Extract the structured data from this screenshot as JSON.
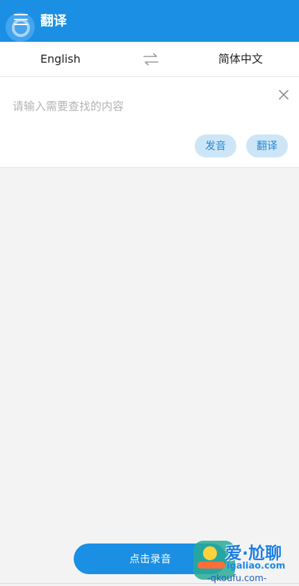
{
  "header": {
    "title": "翻译",
    "background": "#1a8fe3",
    "menu_icon": "hamburger-menu-icon"
  },
  "language_bar": {
    "source_language": "English",
    "target_language": "简体中文",
    "swap_icon": "swap-arrows-icon"
  },
  "input": {
    "value": "",
    "placeholder": "请输入需要查找的内容",
    "clear_icon": "close-icon"
  },
  "actions": {
    "speak_label": "发音",
    "translate_label": "翻译"
  },
  "footer": {
    "record_label": "点击录音"
  },
  "watermark": {
    "title": "爱·尬聊",
    "domain": "igaliao.com",
    "sub": "-qkoufu.com-"
  },
  "colors": {
    "primary": "#1a8fe3",
    "pill_background": "#cde6f7",
    "pill_text": "#2889d6",
    "page_background": "#f3f3f3"
  }
}
